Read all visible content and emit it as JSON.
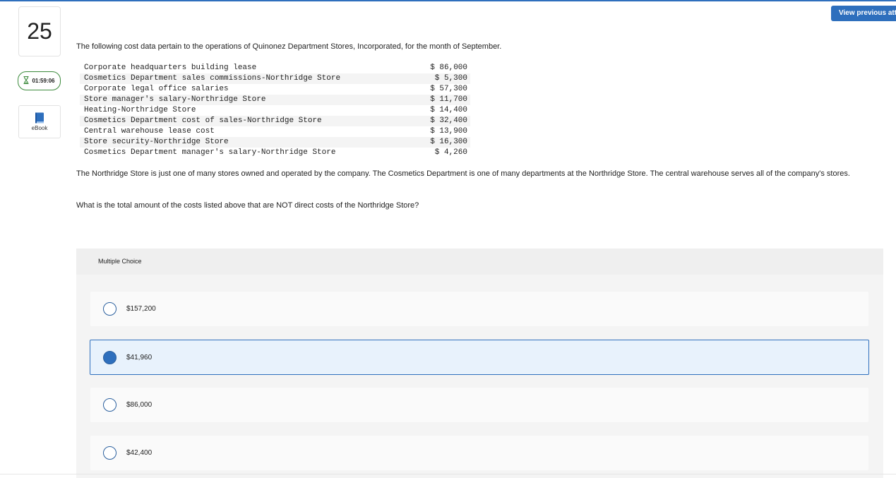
{
  "header": {
    "question_number": "25",
    "timer": "01:59:06",
    "timer_icon": "hourglass-icon",
    "ebook_label": "eBook",
    "ebook_icon": "book-icon",
    "view_previous_label": "View previous attempt"
  },
  "question": {
    "intro": "The following cost data pertain to the operations of Quinonez Department Stores, Incorporated, for the month of September.",
    "costs": [
      {
        "item": "Corporate headquarters building lease",
        "amount": "$ 86,000"
      },
      {
        "item": "Cosmetics Department sales commissions-Northridge Store",
        "amount": "$ 5,300"
      },
      {
        "item": "Corporate legal office salaries",
        "amount": "$ 57,300"
      },
      {
        "item": "Store manager's salary-Northridge Store",
        "amount": "$ 11,700"
      },
      {
        "item": "Heating-Northridge Store",
        "amount": "$ 14,400"
      },
      {
        "item": "Cosmetics Department cost of sales-Northridge Store",
        "amount": "$ 32,400"
      },
      {
        "item": "Central warehouse lease cost",
        "amount": "$ 13,900"
      },
      {
        "item": "Store security-Northridge Store",
        "amount": "$ 16,300"
      },
      {
        "item": "Cosmetics Department manager's salary-Northridge Store",
        "amount": "$ 4,260"
      }
    ],
    "paragraph": "The Northridge Store is just one of many stores owned and operated by the company. The Cosmetics Department is one of many departments at the Northridge Store. The central warehouse serves all of the company's stores.",
    "prompt": "What is the total amount of the costs listed above that are NOT direct costs of the Northridge Store?"
  },
  "multiple_choice": {
    "header": "Multiple Choice",
    "selected_index": 1,
    "options": [
      {
        "label": "$157,200"
      },
      {
        "label": "$41,960"
      },
      {
        "label": "$86,000"
      },
      {
        "label": "$42,400"
      }
    ]
  },
  "colors": {
    "accent": "#2e6fbd",
    "timer_border": "#3b8a3b",
    "selected_bg": "#e8f2fc"
  }
}
